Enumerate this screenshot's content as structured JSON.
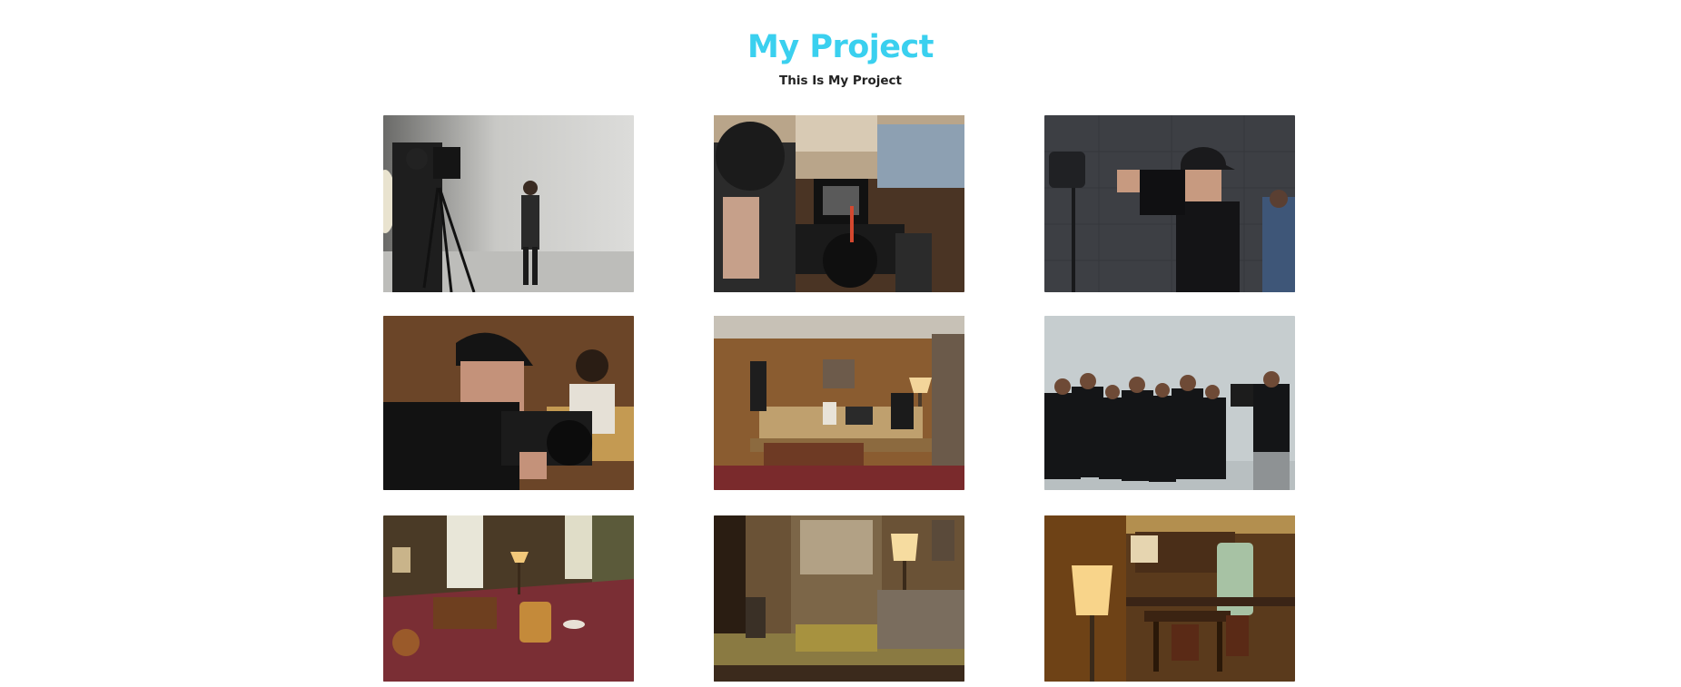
{
  "header": {
    "title": "My Project",
    "subtitle": "This Is My Project"
  },
  "colors": {
    "title": "#3ad0ef",
    "subtitle": "#222222",
    "background": "#ffffff"
  },
  "gallery": {
    "photos": [
      {
        "name": "studio-camera-operator-white-backdrop"
      },
      {
        "name": "camera-closeup-monitor"
      },
      {
        "name": "cameraman-dark-studio-wall"
      },
      {
        "name": "cameraman-profile-wood-paneling"
      },
      {
        "name": "living-room-film-set-crew"
      },
      {
        "name": "group-dance-shoot-grey-backdrop"
      },
      {
        "name": "retro-living-room-red-carpet"
      },
      {
        "name": "retro-room-window-lamp-sofa"
      },
      {
        "name": "retro-kitchen-floor-lamp"
      }
    ]
  }
}
